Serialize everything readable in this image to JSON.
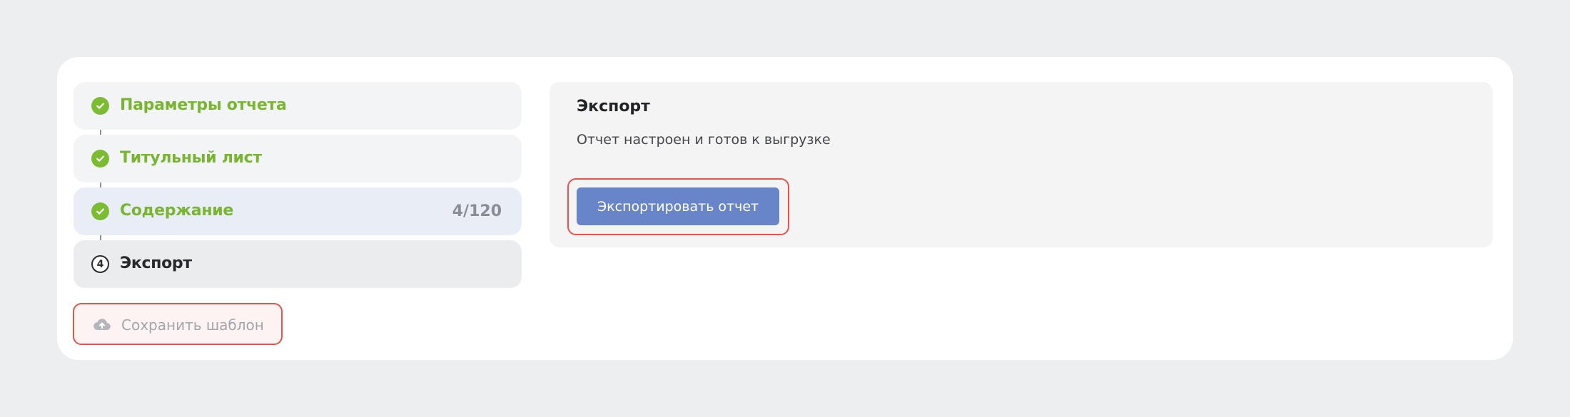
{
  "steps": [
    {
      "label": "Параметры отчета",
      "state": "done"
    },
    {
      "label": "Титульный лист",
      "state": "done"
    },
    {
      "label": "Содержание",
      "state": "done",
      "count": "4/120"
    },
    {
      "label": "Экспорт",
      "state": "current",
      "number": "4"
    }
  ],
  "save_template": {
    "label": "Сохранить шаблон",
    "icon": "cloud-upload-icon"
  },
  "export_panel": {
    "title": "Экспорт",
    "description": "Отчет настроен и готов к выгрузке",
    "button_label": "Экспортировать отчет"
  },
  "colors": {
    "done_green": "#79b532",
    "button_blue": "#6785c8",
    "highlight_red": "#e8524a"
  }
}
